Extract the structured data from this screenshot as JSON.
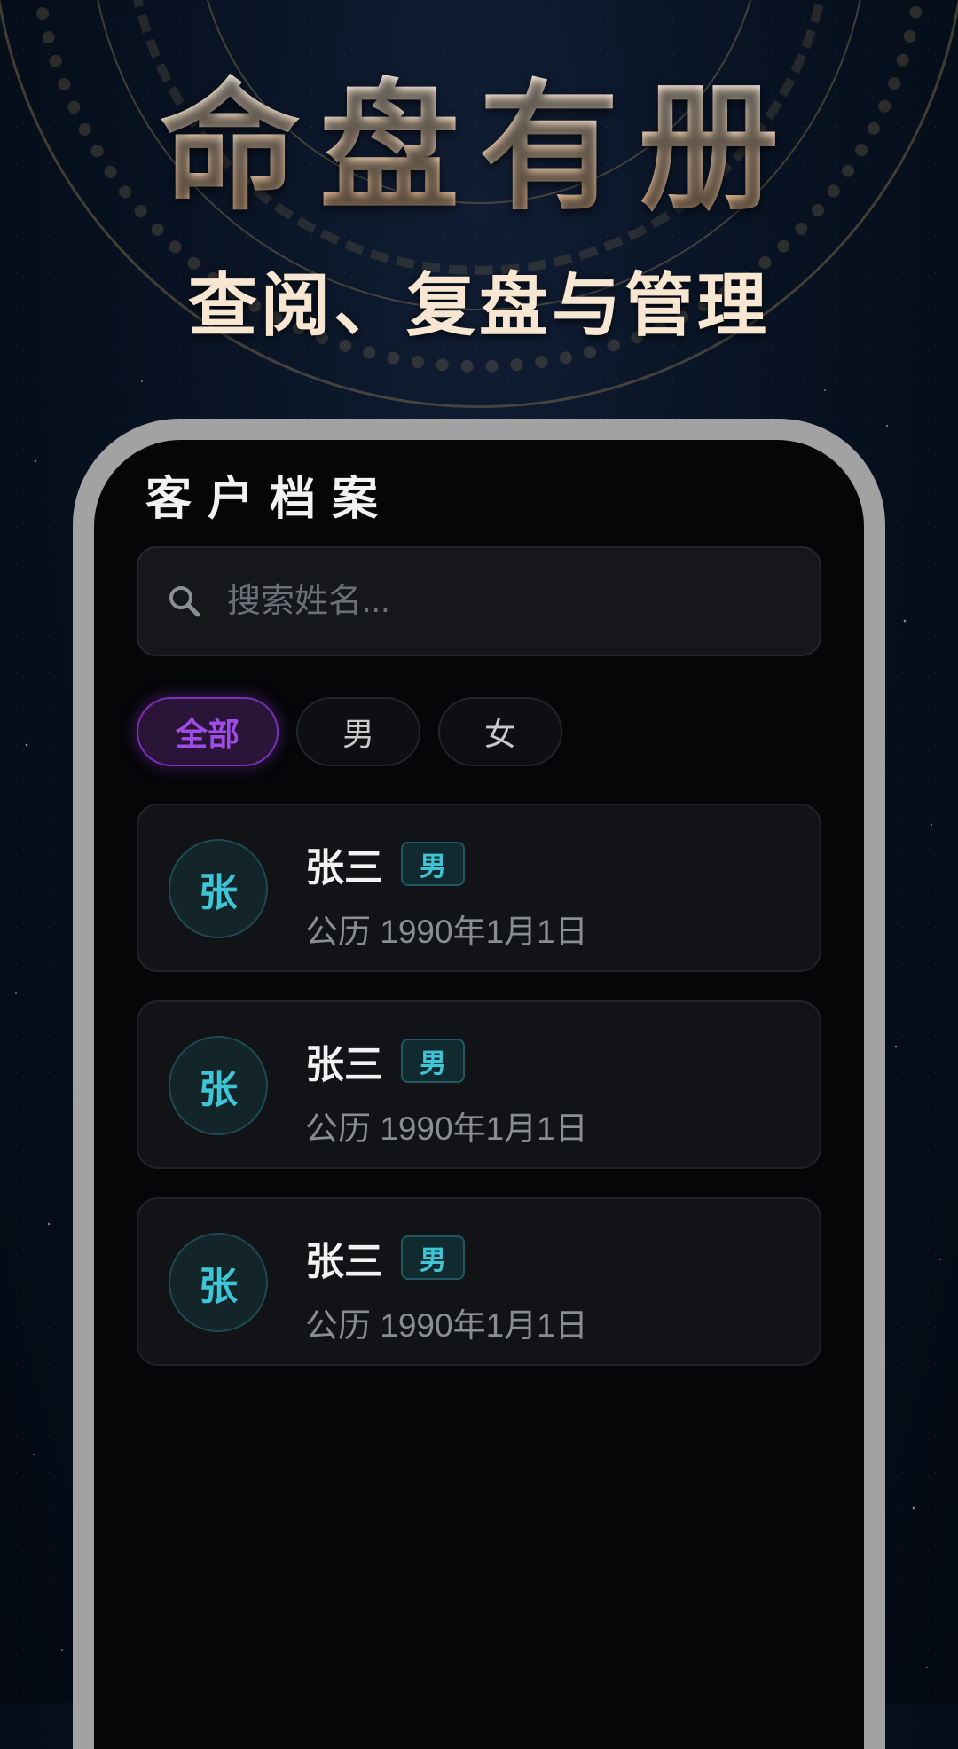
{
  "hero": {
    "title": "命盘有册",
    "subtitle": "查阅、复盘与管理"
  },
  "screen": {
    "title": "客户档案",
    "search": {
      "placeholder": "搜索姓名...",
      "value": "",
      "icon": "search-icon"
    },
    "filters": [
      {
        "label": "全部",
        "active": true
      },
      {
        "label": "男",
        "active": false
      },
      {
        "label": "女",
        "active": false
      }
    ],
    "clients": [
      {
        "avatar": "张",
        "name": "张三",
        "gender": "男",
        "birth": "公历 1990年1月1日"
      },
      {
        "avatar": "张",
        "name": "张三",
        "gender": "男",
        "birth": "公历 1990年1月1日"
      },
      {
        "avatar": "张",
        "name": "张三",
        "gender": "男",
        "birth": "公历 1990年1月1日"
      }
    ]
  },
  "colors": {
    "accent_purple": "#a04be6",
    "accent_cyan": "#3ec5d6",
    "gold_text": "#f3dcc0",
    "phone_frame": "#a2a2a2"
  }
}
